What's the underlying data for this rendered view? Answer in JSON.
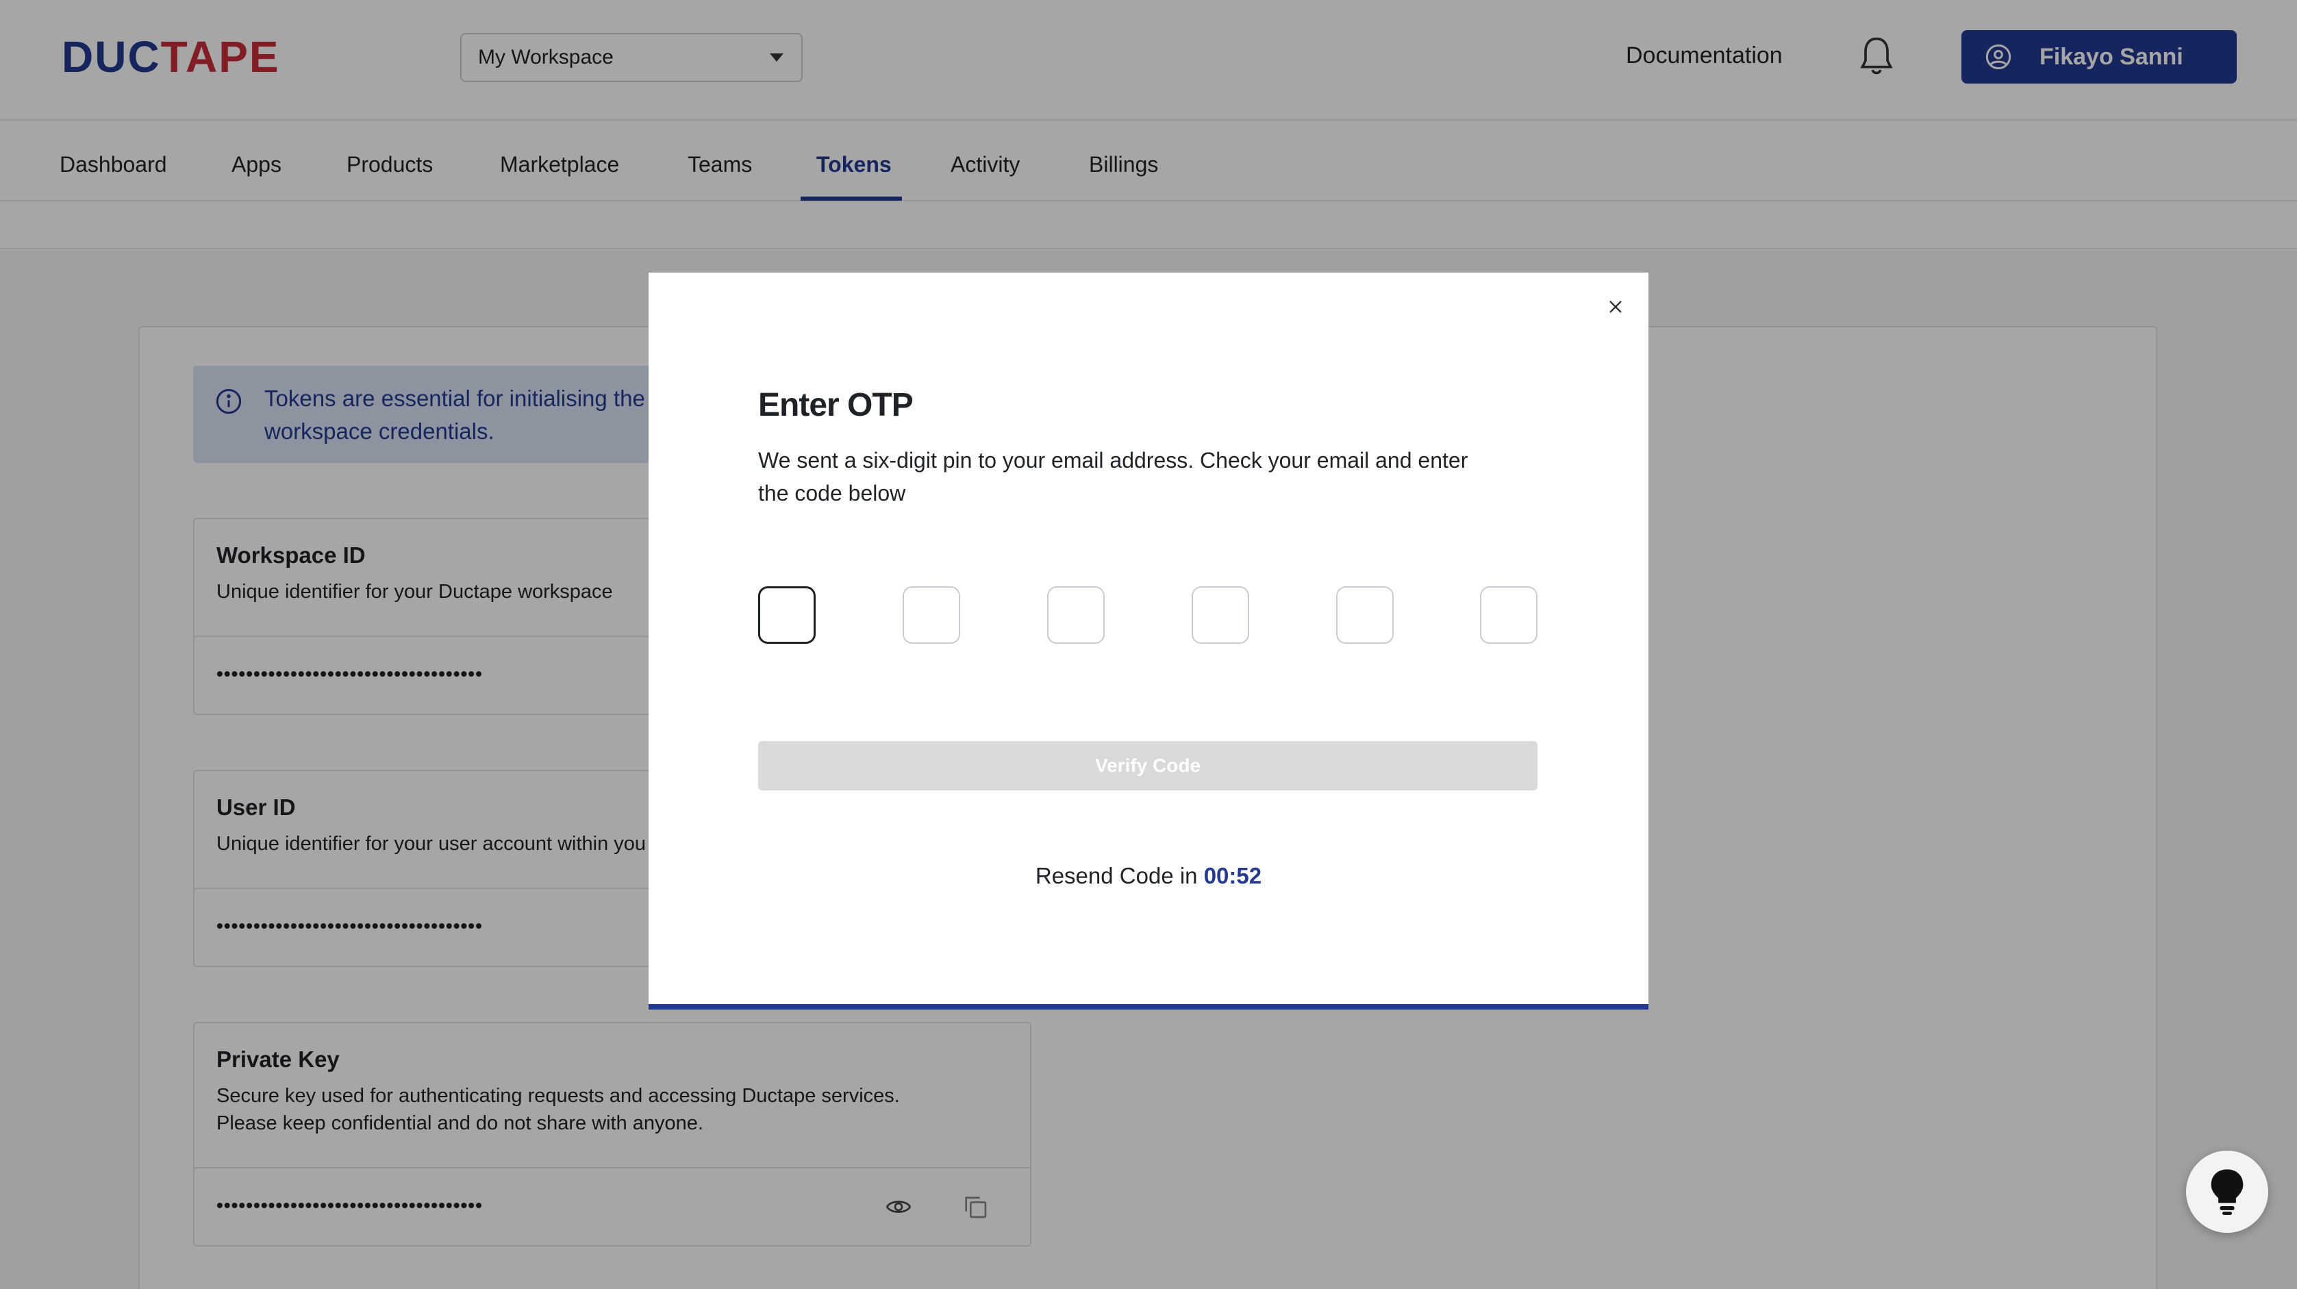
{
  "header": {
    "logo_part1": "DUC",
    "logo_part2": "TAPE",
    "workspace_select": "My Workspace",
    "documentation_link": "Documentation",
    "user_name": "Fikayo Sanni"
  },
  "nav": {
    "items": [
      "Dashboard",
      "Apps",
      "Products",
      "Marketplace",
      "Teams",
      "Tokens",
      "Activity",
      "Billings"
    ],
    "active": "Tokens"
  },
  "info": {
    "text_line1": "Tokens are essential for initialising the",
    "text_line2": "workspace credentials."
  },
  "credentials": [
    {
      "title": "Workspace ID",
      "desc": "Unique identifier for your Ductape workspace",
      "masked": "••••••••••••••••••••••••••••••••••••"
    },
    {
      "title": "User ID",
      "desc": "Unique identifier for your user account within you",
      "masked": "••••••••••••••••••••••••••••••••••••"
    },
    {
      "title": "Private Key",
      "desc_line1": "Secure key used for authenticating requests and accessing Ductape services.",
      "desc_line2": "Please keep confidential and do not share with anyone.",
      "masked": "••••••••••••••••••••••••••••••••••••"
    }
  ],
  "modal": {
    "title": "Enter OTP",
    "desc_line1": "We sent a six-digit pin to your email address. Check your email and enter",
    "desc_line2": "the code below",
    "verify_label": "Verify Code",
    "resend_prefix": "Resend Code in",
    "resend_timer": "00:52"
  },
  "colors": {
    "brand_blue": "#233a8f",
    "brand_red": "#c82d3a",
    "info_bg": "#dbe3f4",
    "disabled_btn": "#d9d9d9"
  },
  "icons": [
    "chevron-down-icon",
    "bell-icon",
    "user-circle-icon",
    "info-icon",
    "eye-icon",
    "copy-icon",
    "close-icon",
    "lightbulb-icon"
  ]
}
